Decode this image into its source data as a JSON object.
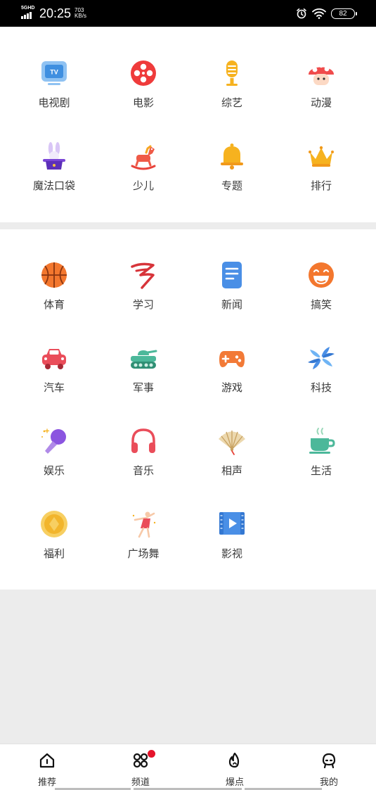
{
  "status_bar": {
    "network": "5GHD",
    "time": "20:25",
    "speed_value": "703",
    "speed_unit": "KB/s",
    "battery": "82"
  },
  "top_section": {
    "items": [
      {
        "label": "电视剧",
        "icon": "tv-icon"
      },
      {
        "label": "电影",
        "icon": "film-reel-icon"
      },
      {
        "label": "综艺",
        "icon": "microphone-icon"
      },
      {
        "label": "动漫",
        "icon": "mushroom-icon"
      },
      {
        "label": "魔法口袋",
        "icon": "magic-hat-icon"
      },
      {
        "label": "少儿",
        "icon": "rocking-horse-icon"
      },
      {
        "label": "专题",
        "icon": "bell-icon"
      },
      {
        "label": "排行",
        "icon": "crown-icon"
      }
    ]
  },
  "main_section": {
    "items": [
      {
        "label": "体育",
        "icon": "basketball-icon"
      },
      {
        "label": "学习",
        "icon": "study-icon"
      },
      {
        "label": "新闻",
        "icon": "document-icon"
      },
      {
        "label": "搞笑",
        "icon": "laughing-face-icon"
      },
      {
        "label": "汽车",
        "icon": "car-icon"
      },
      {
        "label": "军事",
        "icon": "tank-icon"
      },
      {
        "label": "游戏",
        "icon": "gamepad-icon"
      },
      {
        "label": "科技",
        "icon": "pinwheel-icon"
      },
      {
        "label": "娱乐",
        "icon": "karaoke-mic-icon"
      },
      {
        "label": "音乐",
        "icon": "headphones-icon"
      },
      {
        "label": "相声",
        "icon": "folding-fan-icon"
      },
      {
        "label": "生活",
        "icon": "tea-cup-icon"
      },
      {
        "label": "福利",
        "icon": "gold-coin-icon"
      },
      {
        "label": "广场舞",
        "icon": "dancer-icon"
      },
      {
        "label": "影视",
        "icon": "video-play-icon"
      }
    ]
  },
  "tabbar": {
    "tabs": [
      {
        "label": "推荐",
        "icon": "home-icon"
      },
      {
        "label": "频道",
        "icon": "channels-icon"
      },
      {
        "label": "爆点",
        "icon": "flame-icon"
      },
      {
        "label": "我的",
        "icon": "profile-icon"
      }
    ]
  },
  "colors": {
    "status_bar_bg": "#000000",
    "page_bg": "#ececec",
    "panel_bg": "#ffffff",
    "badge_red": "#e5142b",
    "label_text": "#3a3a3a"
  }
}
